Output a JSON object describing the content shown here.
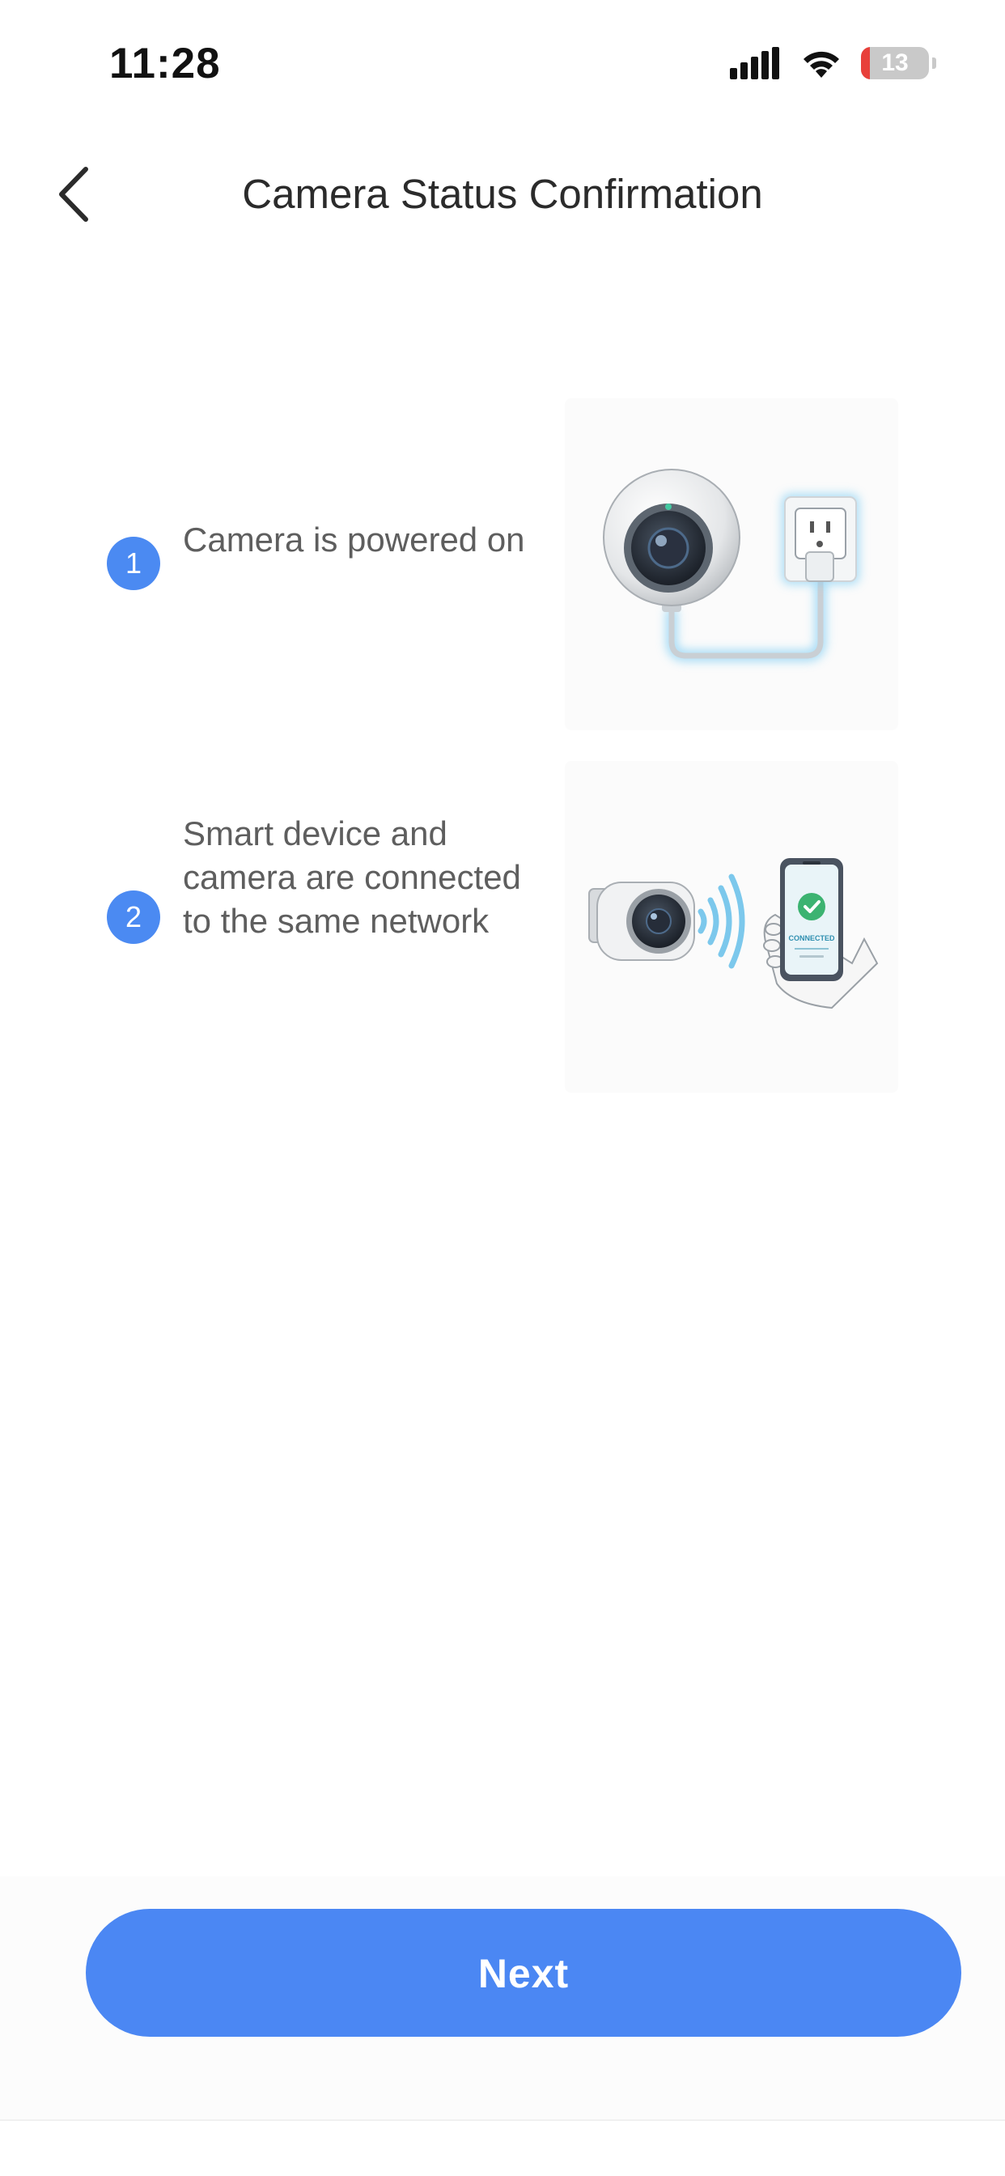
{
  "status_bar": {
    "time": "11:28",
    "battery_text": "13",
    "battery_level": 0.13,
    "icons": [
      "signal-icon",
      "wifi-icon",
      "battery-icon"
    ]
  },
  "nav": {
    "title": "Camera Status Confirmation",
    "back_icon": "chevron-left-icon"
  },
  "steps": [
    {
      "number": "1",
      "text": "Camera is powered on",
      "illustration": "camera-plugged-into-outlet"
    },
    {
      "number": "2",
      "text": "Smart device and camera are connected to the same network",
      "illustration": "camera-and-phone-connected"
    }
  ],
  "illustration_text": {
    "phone_status": "CONNECTED"
  },
  "actions": {
    "next_label": "Next"
  },
  "colors": {
    "accent": "#4b87f3",
    "step_badge": "#4b8af2",
    "battery_low": "#e8403a",
    "glow": "#8fd3f4"
  }
}
